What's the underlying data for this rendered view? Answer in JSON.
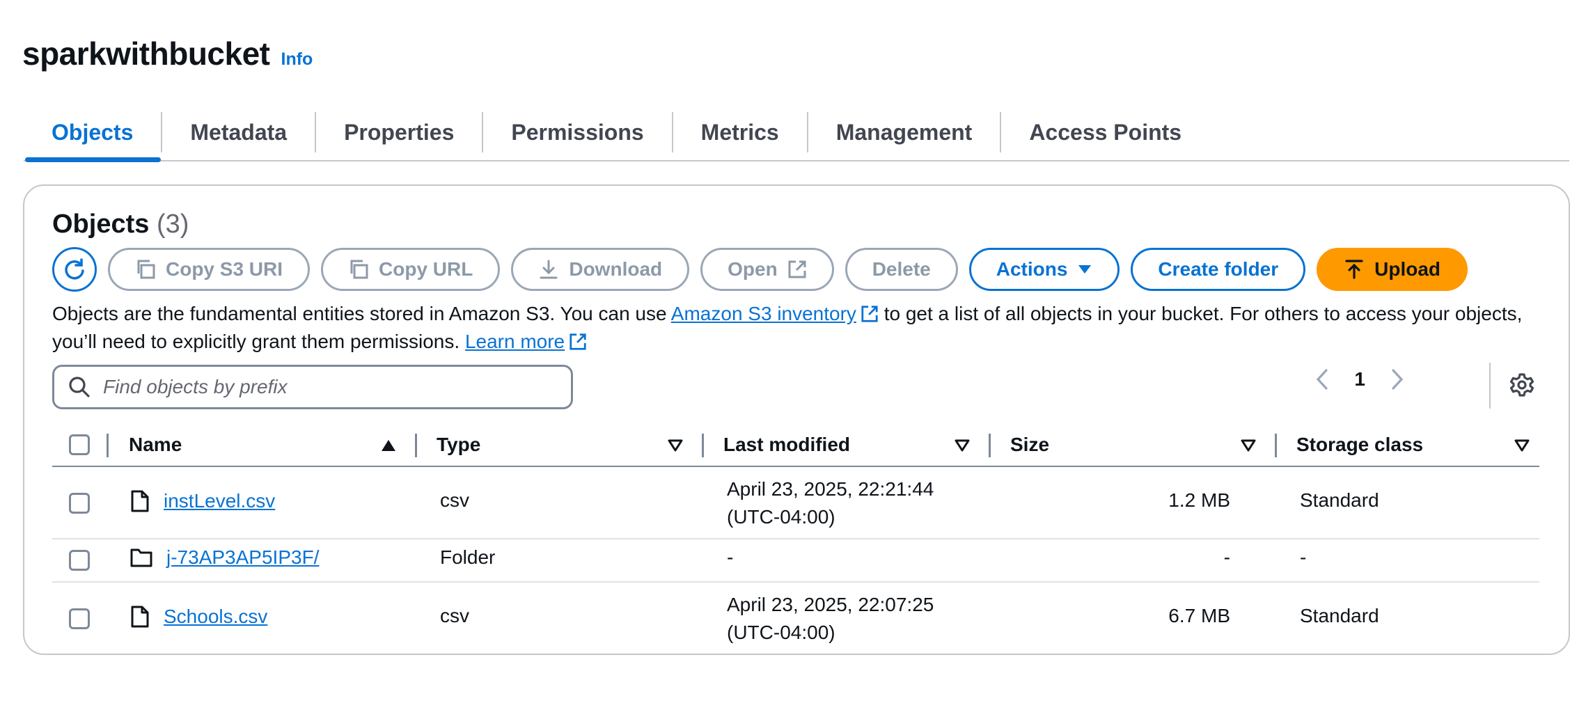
{
  "header": {
    "title": "sparkwithbucket",
    "info": "Info"
  },
  "tabs": [
    {
      "label": "Objects",
      "active": true
    },
    {
      "label": "Metadata"
    },
    {
      "label": "Properties"
    },
    {
      "label": "Permissions"
    },
    {
      "label": "Metrics"
    },
    {
      "label": "Management"
    },
    {
      "label": "Access Points"
    }
  ],
  "objects": {
    "heading": "Objects",
    "count": "(3)",
    "toolbar": {
      "refresh_icon": "refresh-icon",
      "copy_s3_uri": "Copy S3 URI",
      "copy_url": "Copy URL",
      "download": "Download",
      "open": "Open",
      "delete": "Delete",
      "actions": "Actions",
      "create_folder": "Create folder",
      "upload": "Upload"
    },
    "description": {
      "part1": "Objects are the fundamental entities stored in Amazon S3. You can use ",
      "link1": "Amazon S3 inventory",
      "part2": " to get a list of all objects in your bucket. For others to access your objects, you’ll need to explicitly grant them permissions. ",
      "link2": "Learn more"
    },
    "search": {
      "placeholder": "Find objects by prefix"
    },
    "pager": {
      "page": "1"
    },
    "columns": {
      "name": "Name",
      "type": "Type",
      "last_modified": "Last modified",
      "size": "Size",
      "storage_class": "Storage class"
    },
    "rows": [
      {
        "icon": "file-icon",
        "name": "instLevel.csv",
        "type": "csv",
        "modified_line1": "April 23, 2025, 22:21:44",
        "modified_line2": "(UTC-04:00)",
        "size": "1.2 MB",
        "storage_class": "Standard"
      },
      {
        "icon": "folder-icon",
        "name": "j-73AP3AP5IP3F/",
        "type": "Folder",
        "modified_line1": "-",
        "modified_line2": "",
        "size": "-",
        "storage_class": "-"
      },
      {
        "icon": "file-icon",
        "name": "Schools.csv",
        "type": "csv",
        "modified_line1": "April 23, 2025, 22:07:25",
        "modified_line2": "(UTC-04:00)",
        "size": "6.7 MB",
        "storage_class": "Standard"
      }
    ]
  },
  "colors": {
    "accent": "#0972d3",
    "upload": "#ff9900",
    "disabled": "#8d99a8"
  }
}
